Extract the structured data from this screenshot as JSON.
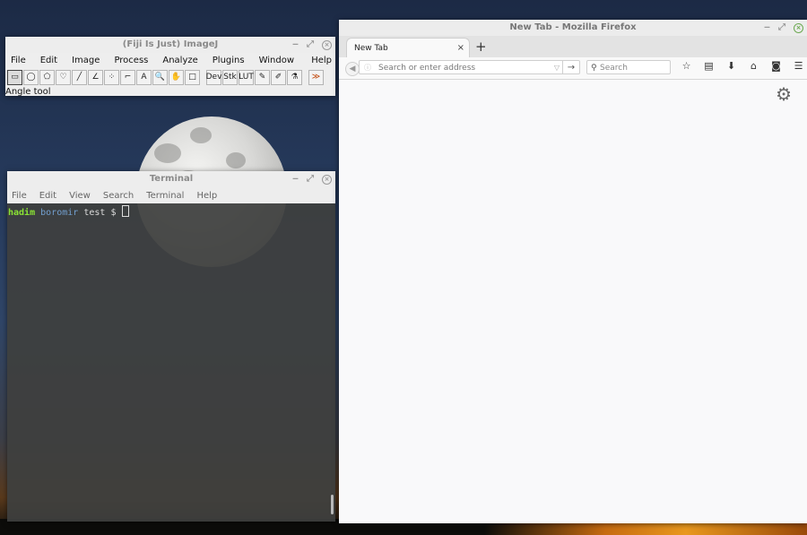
{
  "imagej": {
    "title": "(Fiji Is Just) ImageJ",
    "menu": [
      "File",
      "Edit",
      "Image",
      "Process",
      "Analyze",
      "Plugins",
      "Window"
    ],
    "help": "Help",
    "tools": [
      "▭",
      "◯",
      "⬠",
      "♡",
      "╱",
      "∠",
      "⁘",
      "⌐",
      "A",
      "🔍",
      "✋",
      "□",
      "Dev",
      "Stk",
      "LUT",
      "✎",
      "✐",
      "⚗",
      "≫"
    ],
    "status": "Angle tool"
  },
  "terminal": {
    "title": "Terminal",
    "menu": [
      "File",
      "Edit",
      "View",
      "Search",
      "Terminal",
      "Help"
    ],
    "prompt_user": "hadim",
    "prompt_host": "boromir",
    "prompt_dir": "test",
    "prompt_symbol": "$"
  },
  "firefox": {
    "title": "New Tab - Mozilla Firefox",
    "tab_label": "New Tab",
    "tab_close": "×",
    "new_tab": "+",
    "url_placeholder": "Search or enter address",
    "search_placeholder": "Search"
  },
  "window_controls": {
    "minimize": "‒",
    "maximize": "⤢",
    "close": "×"
  }
}
